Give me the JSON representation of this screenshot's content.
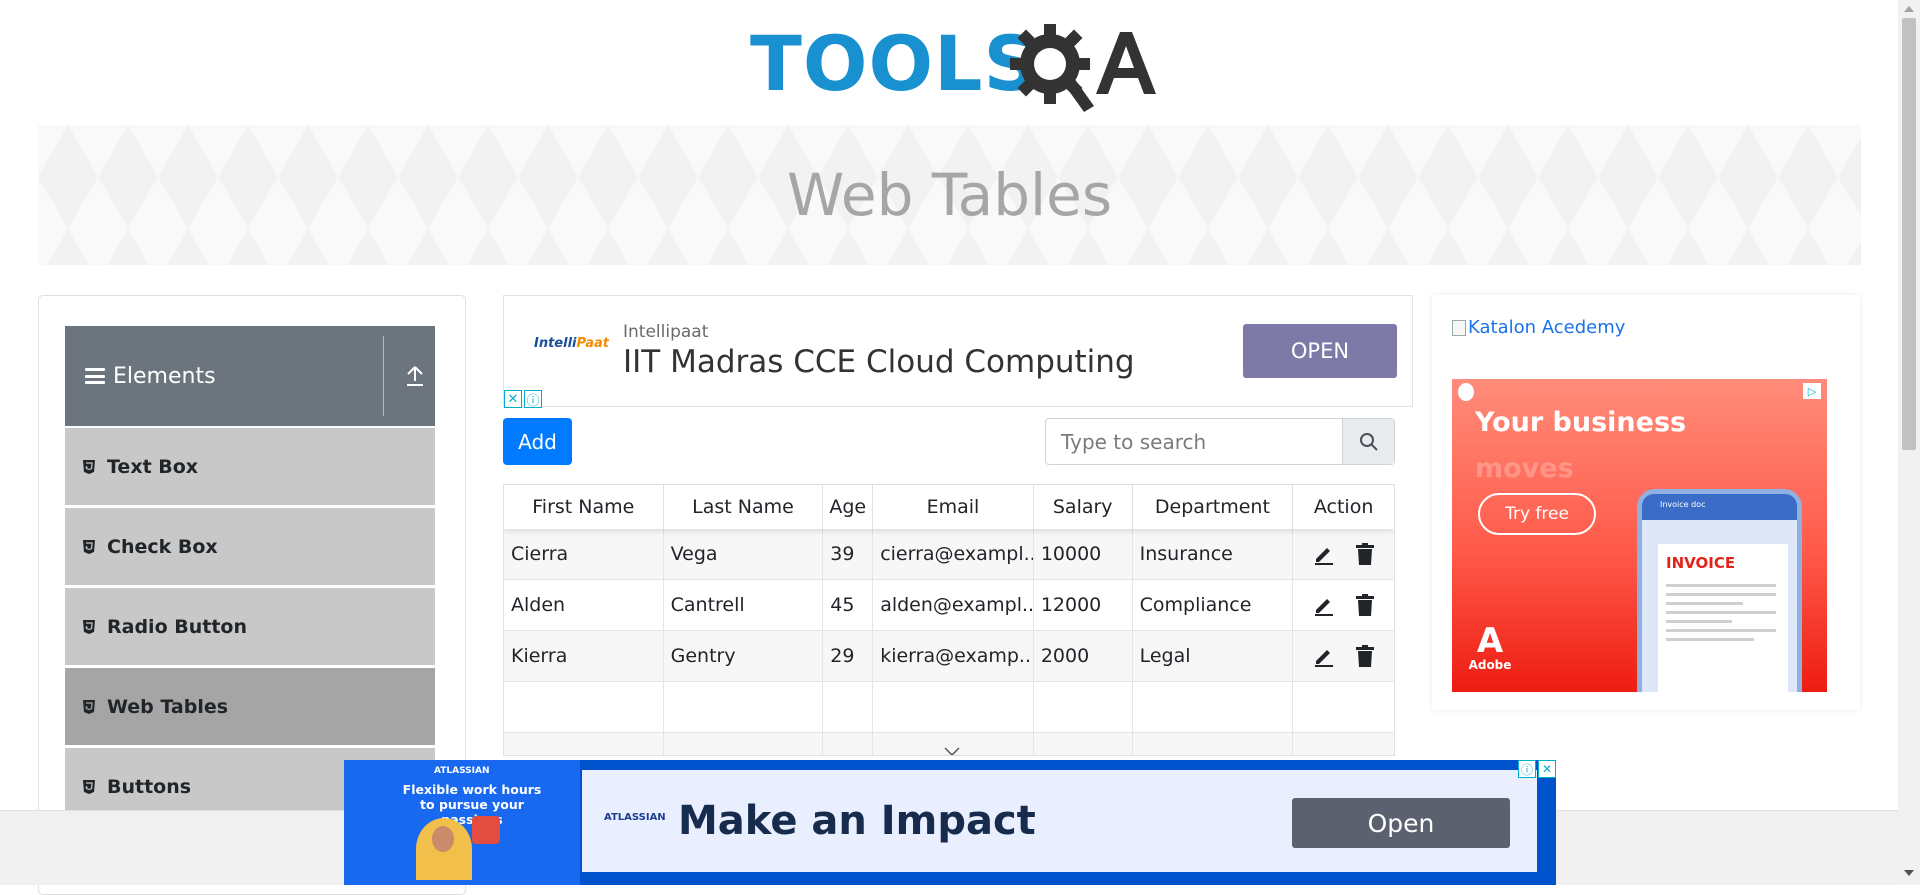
{
  "header": {
    "logo_text": "TOOLS",
    "logo_suffix": "QA"
  },
  "banner": {
    "title": "Web Tables"
  },
  "sidebar": {
    "group_title": "Elements",
    "items": [
      {
        "label": "Text Box",
        "active": false
      },
      {
        "label": "Check Box",
        "active": false
      },
      {
        "label": "Radio Button",
        "active": false
      },
      {
        "label": "Web Tables",
        "active": true
      },
      {
        "label": "Buttons",
        "active": false
      }
    ]
  },
  "ad_top": {
    "brand_logo": "IntelliPaat",
    "advertiser": "Intellipaat",
    "headline": "IIT Madras CCE Cloud Computing",
    "button": "OPEN"
  },
  "toolbar": {
    "add_label": "Add",
    "search_placeholder": "Type to search"
  },
  "table": {
    "columns": [
      "First Name",
      "Last Name",
      "Age",
      "Email",
      "Salary",
      "Department",
      "Action"
    ],
    "rows": [
      [
        "Cierra",
        "Vega",
        "39",
        "cierra@exampl...",
        "10000",
        "Insurance"
      ],
      [
        "Alden",
        "Cantrell",
        "45",
        "alden@exampl...",
        "12000",
        "Compliance"
      ],
      [
        "Kierra",
        "Gentry",
        "29",
        "kierra@examp...",
        "2000",
        "Legal"
      ]
    ]
  },
  "ad_right": {
    "image_alt": "Katalon Acedemy",
    "headline": "Your business",
    "headline_faded": "moves",
    "button": "Try free",
    "mock_title": "Invoice doc",
    "mock_invoice": "INVOICE",
    "brand": "Adobe"
  },
  "ad_bottom": {
    "creative_brand": "ATLASSIAN",
    "creative_text": "Flexible work hours to pursue your passions",
    "brand": "ATLASSIAN",
    "headline": "Make an Impact",
    "button": "Open"
  },
  "colors": {
    "logo_blue": "#1991d0",
    "add_button": "#007bff",
    "sidebar_header": "#6c757d",
    "open_button": "#7e7aa8",
    "bottom_ad": "#0052cc"
  }
}
